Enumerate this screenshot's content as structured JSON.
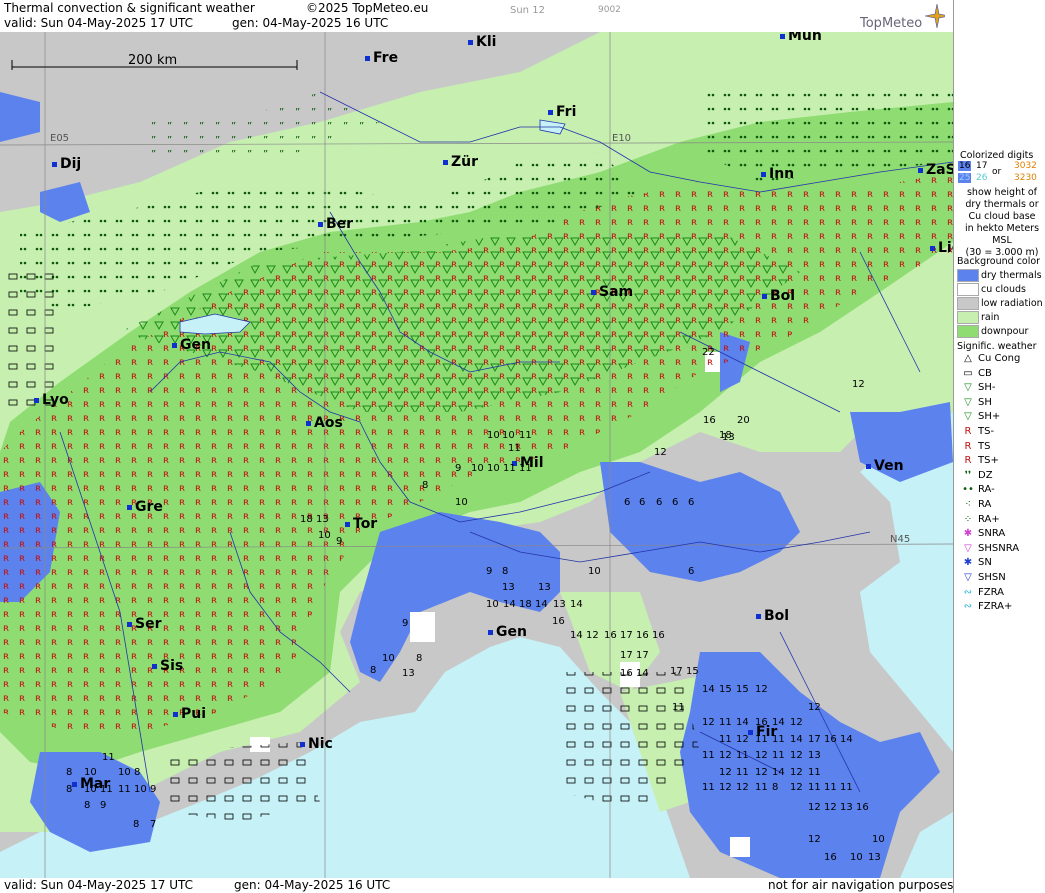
{
  "header": {
    "title": "Thermal convection & significant weather",
    "copyright": "©2025 TopMeteo.eu",
    "valid": "valid:  Sun  04-May-2025  17 UTC",
    "gen": "gen: 04-May-2025 16 UTC",
    "run_tag": "Sun 12",
    "code": "9002",
    "logo": "TopMeteo"
  },
  "scale_label": "200 km",
  "grid_labels": {
    "e05": "E05",
    "e10": "E10",
    "n45": "N45"
  },
  "cities": [
    {
      "name": "Kli"
    },
    {
      "name": "Mün"
    },
    {
      "name": "Fre"
    },
    {
      "name": "Fri"
    },
    {
      "name": "Dij"
    },
    {
      "name": "Zür"
    },
    {
      "name": "Inn"
    },
    {
      "name": "ZaS"
    },
    {
      "name": "Ber"
    },
    {
      "name": "Lie"
    },
    {
      "name": "Sam"
    },
    {
      "name": "Bol"
    },
    {
      "name": "Gen"
    },
    {
      "name": "Lyo"
    },
    {
      "name": "Aos"
    },
    {
      "name": "Mil"
    },
    {
      "name": "Ven"
    },
    {
      "name": "Gre"
    },
    {
      "name": "Tor"
    },
    {
      "name": "Gen"
    },
    {
      "name": "Bol"
    },
    {
      "name": "Ser"
    },
    {
      "name": "Sis"
    },
    {
      "name": "Pui"
    },
    {
      "name": "Nic"
    },
    {
      "name": "Fir"
    },
    {
      "name": "Mar"
    }
  ],
  "numbers": [
    "10",
    "10",
    "11",
    "11",
    "9",
    "10",
    "10",
    "11",
    "11",
    "8",
    "10",
    "18",
    "13",
    "10",
    "9",
    "22",
    "16",
    "18",
    "20",
    "13",
    "12",
    "12",
    "6",
    "6",
    "6",
    "6",
    "6",
    "9",
    "8",
    "13",
    "13",
    "10",
    "14",
    "18",
    "14",
    "13",
    "14",
    "9",
    "10",
    "6",
    "16",
    "14",
    "12",
    "16",
    "17",
    "16",
    "17",
    "17",
    "16",
    "16",
    "14",
    "13",
    "17",
    "15",
    "14",
    "15",
    "15",
    "12",
    "11",
    "12",
    "11",
    "14",
    "16",
    "14",
    "12",
    "11",
    "12",
    "11",
    "11",
    "12",
    "14",
    "17",
    "16",
    "14",
    "11",
    "12",
    "11",
    "12",
    "11",
    "12",
    "13",
    "12",
    "11",
    "12",
    "14",
    "12",
    "11",
    "11",
    "12",
    "12",
    "11",
    "8",
    "12",
    "11",
    "11",
    "11",
    "12",
    "12",
    "13",
    "16",
    "10",
    "12",
    "16",
    "10",
    "13",
    "10",
    "10",
    "8",
    "10",
    "11",
    "11",
    "10",
    "9",
    "8",
    "8",
    "9",
    "8",
    "11",
    "10",
    "8",
    "8",
    "7",
    "8",
    "13"
  ],
  "footer": {
    "valid": "valid:  Sun  04-May-2025  17 UTC",
    "gen": "gen: 04-May-2025 16 UTC",
    "note": "not for air navigation purposes"
  },
  "legend": {
    "digits_title": "Colorized digits",
    "digits_ex1a": "16",
    "digits_ex1b": "17",
    "digits_ex2a": "25",
    "digits_ex2b": "26",
    "digits_or": "or",
    "digits_ex3": "3032",
    "digits_ex4": "3230",
    "digits_text1": "show height of",
    "digits_text2": "dry thermals or",
    "digits_text3": "Cu cloud base",
    "digits_text4": "in hekto Meters",
    "digits_text5": "MSL",
    "digits_text6": "(30 = 3.000 m)",
    "bg_title": "Background color",
    "bg_items": [
      {
        "label": "dry thermals",
        "color": "#5c82ee"
      },
      {
        "label": "cu clouds",
        "color": "#ffffff"
      },
      {
        "label": "low radiation",
        "color": "#c8c8c8"
      },
      {
        "label": "rain",
        "color": "#c6efb0"
      },
      {
        "label": "downpour",
        "color": "#8fdc72"
      }
    ],
    "wx_title": "Signific. weather",
    "wx_items": [
      {
        "sym": "△",
        "label": "Cu Cong",
        "color": "#000000"
      },
      {
        "sym": "▭",
        "label": "CB",
        "color": "#000000"
      },
      {
        "sym": "▽",
        "label": "SH-",
        "color": "#1a8a1a"
      },
      {
        "sym": "▽",
        "label": "SH",
        "color": "#1a8a1a"
      },
      {
        "sym": "▽",
        "label": "SH+",
        "color": "#1a8a1a"
      },
      {
        "sym": "R",
        "label": "TS-",
        "color": "#c01010"
      },
      {
        "sym": "R",
        "label": "TS",
        "color": "#c01010"
      },
      {
        "sym": "R",
        "label": "TS+",
        "color": "#c01010"
      },
      {
        "sym": "❜❜",
        "label": "DZ",
        "color": "#0a5a0a"
      },
      {
        "sym": "••",
        "label": "RA-",
        "color": "#0a5a0a"
      },
      {
        "sym": "⁖",
        "label": "RA",
        "color": "#0a5a0a"
      },
      {
        "sym": "⁘",
        "label": "RA+",
        "color": "#0a5a0a"
      },
      {
        "sym": "✱",
        "label": "SNRA",
        "color": "#d040d0"
      },
      {
        "sym": "▽",
        "label": "SHSNRA",
        "color": "#d040d0"
      },
      {
        "sym": "✱",
        "label": "SN",
        "color": "#2040d0"
      },
      {
        "sym": "▽",
        "label": "SHSN",
        "color": "#2040d0"
      },
      {
        "sym": "∾",
        "label": "FZRA",
        "color": "#20b0d0"
      },
      {
        "sym": "∾",
        "label": "FZRA+",
        "color": "#20b0d0"
      }
    ]
  },
  "colors": {
    "sea": "#c6f1f7",
    "low_radiation": "#c8c8c8",
    "rain": "#c6efb0",
    "downpour": "#8fdc72",
    "dry": "#5c82ee",
    "city_marker": "#1030d0"
  }
}
